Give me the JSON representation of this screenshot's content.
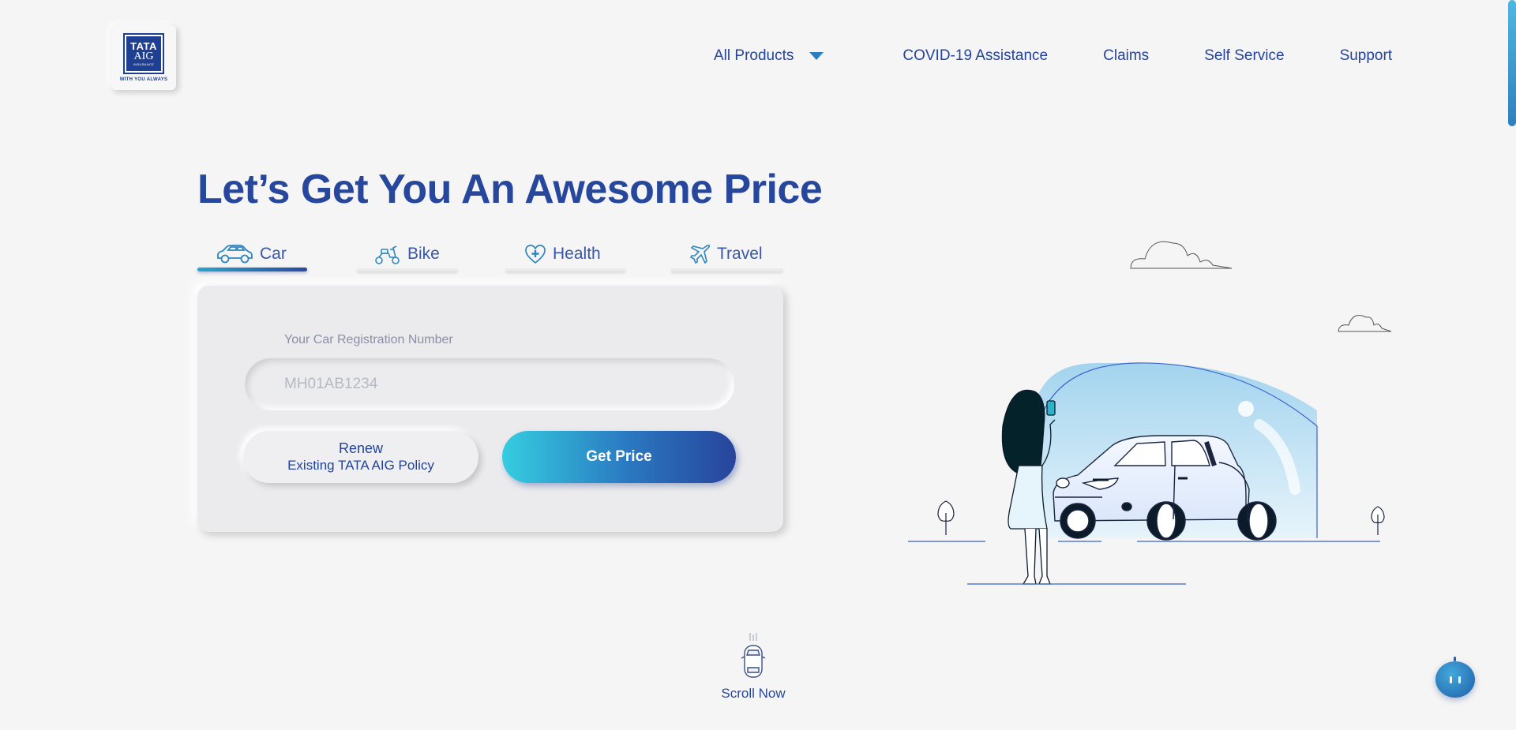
{
  "logo": {
    "line1": "TATA",
    "line2": "AIG",
    "line3": "INSURANCE",
    "tagline": "WITH YOU ALWAYS"
  },
  "nav": {
    "items": [
      {
        "label": "All Products",
        "has_dropdown": true
      },
      {
        "label": "COVID-19 Assistance"
      },
      {
        "label": "Claims"
      },
      {
        "label": "Self Service"
      },
      {
        "label": "Support"
      }
    ]
  },
  "hero": {
    "headline": "Let’s Get You An Awesome Price"
  },
  "tabs": [
    {
      "label": "Car",
      "icon": "car-icon",
      "active": true
    },
    {
      "label": "Bike",
      "icon": "scooter-icon",
      "active": false
    },
    {
      "label": "Health",
      "icon": "heart-plus-icon",
      "active": false
    },
    {
      "label": "Travel",
      "icon": "airplane-icon",
      "active": false
    }
  ],
  "form": {
    "field_label": "Your Car Registration Number",
    "placeholder": "MH01AB1234",
    "value": "",
    "renew_line1": "Renew",
    "renew_line2": "Existing TATA AIG Policy",
    "get_price_label": "Get Price"
  },
  "scroll": {
    "label": "Scroll Now"
  },
  "colors": {
    "primary": "#27479c",
    "accent_start": "#35cde0",
    "accent_end": "#27449b",
    "background": "#f5f5f5"
  }
}
